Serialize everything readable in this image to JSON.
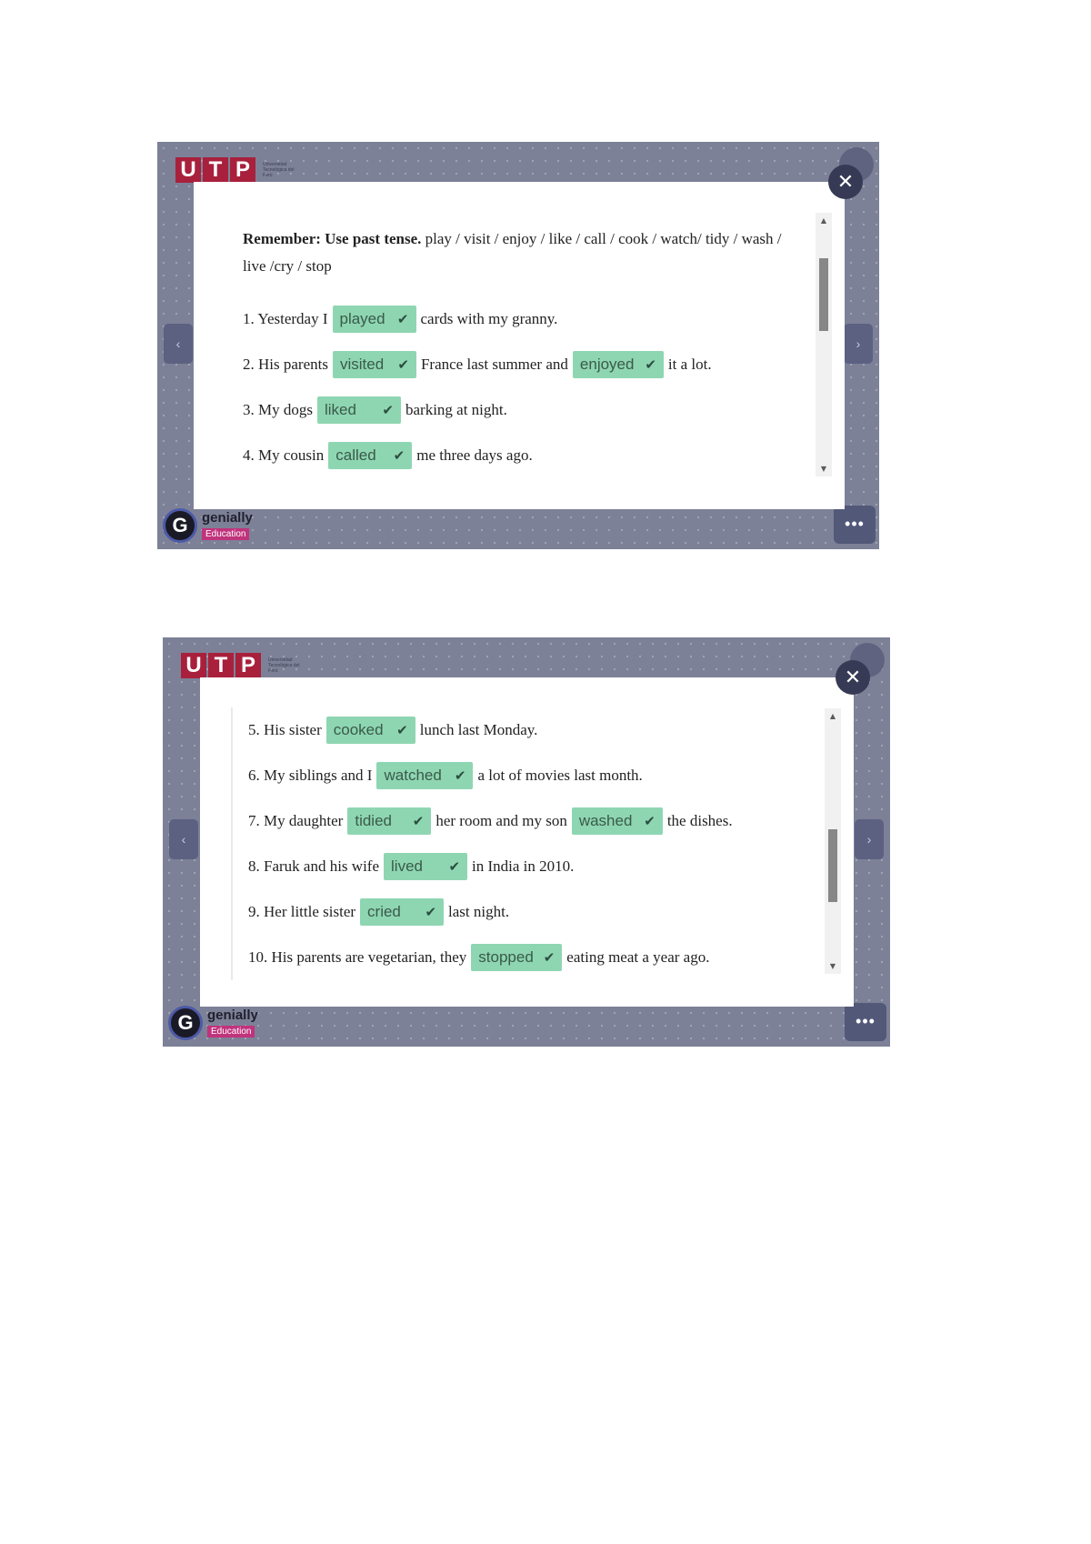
{
  "slides": [
    {
      "logo": {
        "letters": [
          "U",
          "T",
          "P"
        ],
        "subtitle": "Universidad Tecnológica del Perú"
      },
      "brand": {
        "name": "genially",
        "tag": "Education",
        "icon": "genially-g-icon"
      },
      "nav": {
        "prev_icon": "‹",
        "next_icon": "›",
        "menu_icon": "•••"
      },
      "close_icon": "✕",
      "intro": {
        "bold": "Remember: Use past tense.",
        "words": "play / visit / enjoy / like / call / cook / watch/ tidy / wash / live /cry / stop"
      },
      "items": [
        {
          "n": "1. Yesterday I",
          "a1": "played",
          "mid": "cards with my granny."
        },
        {
          "n": "2. His parents",
          "a1": "visited",
          "mid": "France last summer and",
          "a2": "enjoyed",
          "end": "it a lot."
        },
        {
          "n": "3. My dogs",
          "a1": "liked",
          "mid": "barking at night."
        },
        {
          "n": "4. My cousin",
          "a1": "called",
          "mid": "me three days ago."
        }
      ],
      "scroll_fraction": 0.15
    },
    {
      "logo": {
        "letters": [
          "U",
          "T",
          "P"
        ],
        "subtitle": "Universidad Tecnológica del Perú"
      },
      "brand": {
        "name": "genially",
        "tag": "Education",
        "icon": "genially-g-icon"
      },
      "nav": {
        "prev_icon": "‹",
        "next_icon": "›",
        "menu_icon": "•••"
      },
      "close_icon": "✕",
      "items": [
        {
          "n": "5. His sister",
          "a1": "cooked",
          "mid": "lunch last Monday."
        },
        {
          "n": "6. My siblings and I",
          "a1": "watched",
          "mid": "a lot of movies last month."
        },
        {
          "n": "7. My daughter",
          "a1": "tidied",
          "mid": "her room and my son",
          "a2": "washed",
          "end": "the dishes."
        },
        {
          "n": "8. Faruk and his wife",
          "a1": "lived",
          "mid": "in India in 2010."
        },
        {
          "n": "9. Her little sister",
          "a1": "cried",
          "mid": "last night."
        },
        {
          "n": "10. His parents are vegetarian, they",
          "a1": "stopped",
          "mid": "eating meat a year ago."
        }
      ],
      "scroll_fraction": 0.55
    }
  ],
  "check_icon": "✔",
  "colors": {
    "answer_bg": "#8ed6b2",
    "backdrop": "#7d8197",
    "logo_red": "#a8203c",
    "tag_pink": "#c0337d"
  }
}
